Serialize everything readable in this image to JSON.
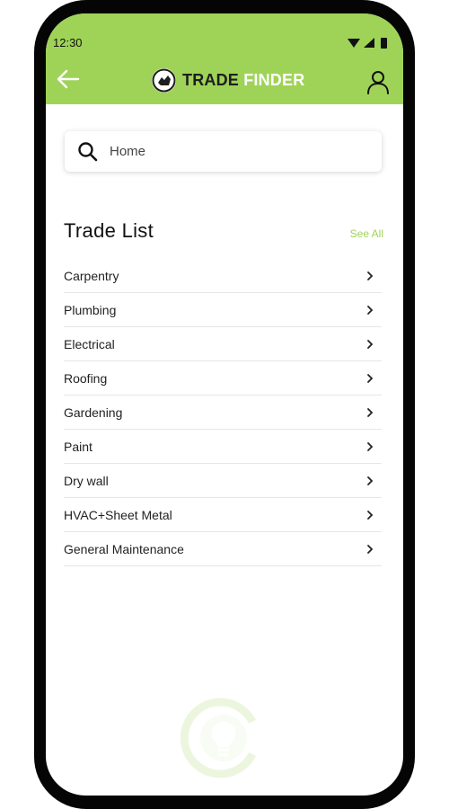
{
  "status": {
    "time": "12:30"
  },
  "header": {
    "logo_word1": "TRADE",
    "logo_word2": "FINDER",
    "back_icon": "arrow-left-icon",
    "profile_icon": "user-icon",
    "background": "#9fd357"
  },
  "search": {
    "value": "",
    "placeholder": "Home"
  },
  "trade_list": {
    "title": "Trade List",
    "see_all": "See All",
    "items": [
      {
        "label": "Carpentry"
      },
      {
        "label": "Plumbing"
      },
      {
        "label": "Electrical"
      },
      {
        "label": "Roofing"
      },
      {
        "label": "Gardening"
      },
      {
        "label": "Paint"
      },
      {
        "label": "Dry wall"
      },
      {
        "label": "HVAC+Sheet Metal"
      },
      {
        "label": "General Maintenance"
      }
    ]
  },
  "colors": {
    "accent": "#9fd357",
    "text": "#222222",
    "divider": "#e6e6e6"
  }
}
